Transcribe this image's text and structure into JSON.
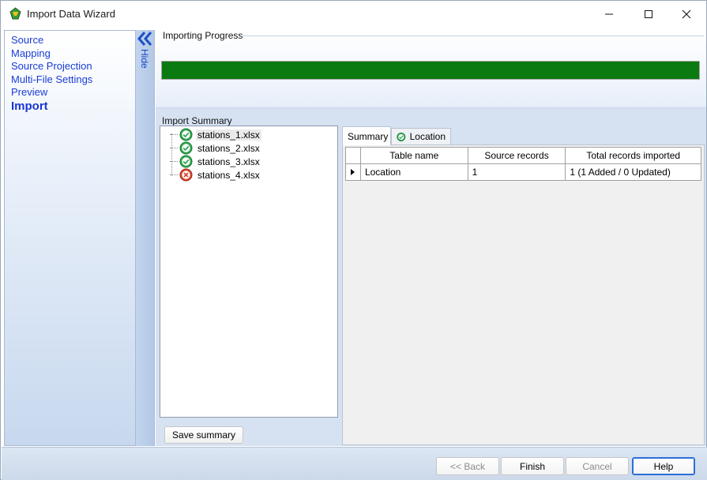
{
  "window": {
    "title": "Import Data Wizard",
    "controls": [
      "minimize-icon",
      "maximize-icon",
      "close-icon"
    ]
  },
  "steps": {
    "items": [
      "Source",
      "Mapping",
      "Source Projection",
      "Multi-File Settings",
      "Preview",
      "Import"
    ],
    "active": "Import"
  },
  "hide_panel": {
    "label": "Hide",
    "icon": "double-chevron-left-icon"
  },
  "progress": {
    "label": "Importing Progress",
    "fraction": 1.0,
    "color": "#0b7a10"
  },
  "import_summary": {
    "label": "Import Summary",
    "files": [
      {
        "name": "stations_1.xlsx",
        "status": "success",
        "icon": "check-circle-icon"
      },
      {
        "name": "stations_2.xlsx",
        "status": "success",
        "icon": "check-circle-icon"
      },
      {
        "name": "stations_3.xlsx",
        "status": "success",
        "icon": "check-circle-icon"
      },
      {
        "name": "stations_4.xlsx",
        "status": "error",
        "icon": "error-circle-icon"
      }
    ],
    "selected": "stations_1.xlsx",
    "save_button": "Save summary"
  },
  "tabs": {
    "summary": "Summary",
    "location": "Location"
  },
  "grid": {
    "headers": [
      "Table name",
      "Source records",
      "Total records imported"
    ],
    "rows": [
      [
        "Location",
        "1",
        "1 (1 Added / 0 Updated)"
      ]
    ]
  },
  "buttons": {
    "back": "<< Back",
    "finish": "Finish",
    "cancel": "Cancel",
    "help": "Help"
  },
  "colors": {
    "success": "#2fa84f",
    "error": "#d8472f",
    "step_link": "#1a3dd6"
  }
}
